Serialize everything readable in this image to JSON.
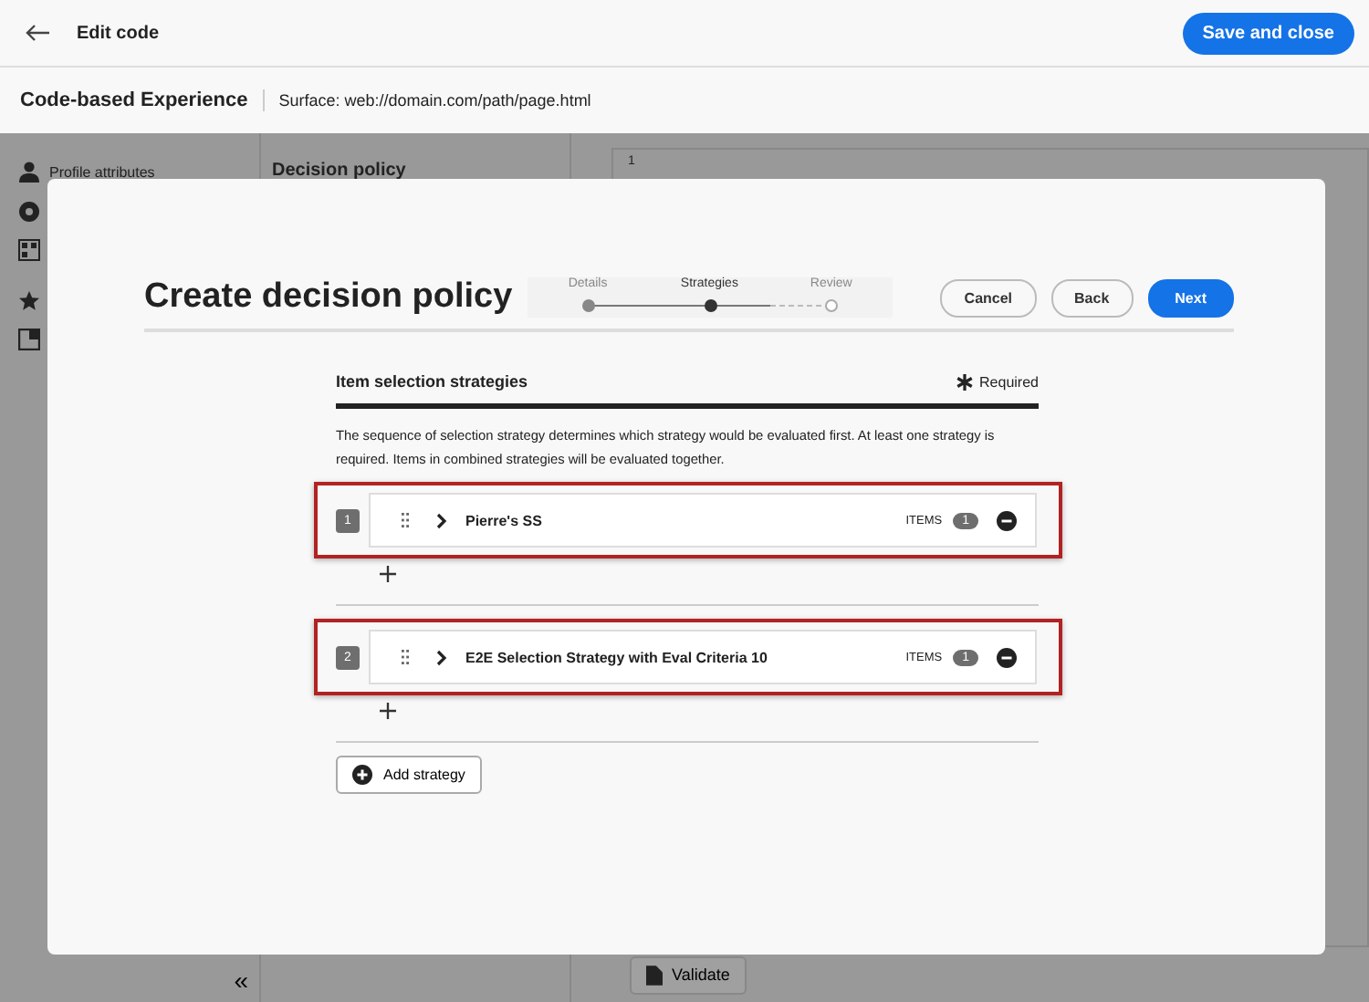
{
  "top_bar": {
    "title": "Edit code",
    "save_button": "Save and close"
  },
  "sub_header": {
    "title": "Code-based Experience",
    "surface": "Surface: web://domain.com/path/page.html"
  },
  "sidebar": {
    "items": [
      {
        "label": "Profile attributes"
      }
    ]
  },
  "panel": {
    "title": "Decision policy"
  },
  "editor": {
    "line_number": "1",
    "validate_button": "Validate"
  },
  "collapse_button": "«",
  "modal": {
    "title": "Create decision policy",
    "steps": [
      {
        "label": "Details",
        "selected": false,
        "completed": true
      },
      {
        "label": "Strategies",
        "selected": true,
        "completed": false
      },
      {
        "label": "Review",
        "selected": false,
        "completed": false
      }
    ],
    "buttons": [
      {
        "label": "Cancel",
        "kind": "secondary"
      },
      {
        "label": "Back",
        "kind": "secondary"
      },
      {
        "label": "Next",
        "kind": "primary"
      }
    ],
    "section_title": "Item selection strategies",
    "required": "Required",
    "description": "The sequence of selection strategy determines which strategy would be evaluated first. At least one strategy is required. Items in combined strategies will be evaluated together.",
    "strategies": [
      {
        "number": "1",
        "name": "Pierre's SS",
        "items_label": "ITEMS",
        "count": "1",
        "highlighted": true
      },
      {
        "number": "2",
        "name": "E2E Selection Strategy with Eval Criteria 10",
        "items_label": "ITEMS",
        "count": "1",
        "highlighted": true
      }
    ],
    "add_button": "Add strategy"
  }
}
